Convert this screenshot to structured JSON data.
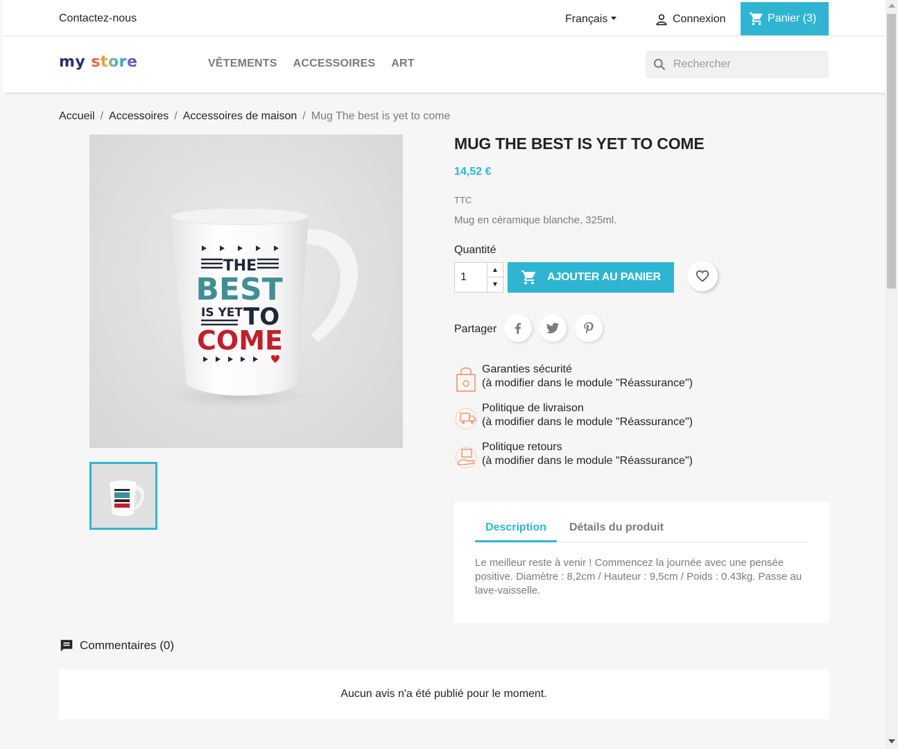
{
  "topbar": {
    "contact": "Contactez-nous",
    "language": "Français",
    "login": "Connexion",
    "cart": "Panier (3)"
  },
  "header": {
    "logo_my": "my",
    "logo_store": "store",
    "nav": [
      "VÊTEMENTS",
      "ACCESSOIRES",
      "ART"
    ],
    "search_placeholder": "Rechercher"
  },
  "breadcrumb": [
    "Accueil",
    "Accessoires",
    "Accessoires de maison",
    "Mug The best is yet to come"
  ],
  "product": {
    "title": "MUG THE BEST IS YET TO COME",
    "price": "14,52 €",
    "tax_label": "TTC",
    "short_description": "Mug en céramique blanche, 325ml.",
    "quantity_label": "Quantité",
    "quantity_value": "1",
    "add_to_cart": "AJOUTER AU PANIER",
    "share_label": "Partager",
    "mug_text": {
      "the": "THE",
      "best": "BEST",
      "is_yet": "IS YET",
      "to": "TO",
      "come": "COME"
    }
  },
  "reassurance": [
    {
      "title": "Garanties sécurité",
      "subtitle": "(à modifier dans le module \"Réassurance\")",
      "icon": "secure-bag-icon"
    },
    {
      "title": "Politique de livraison",
      "subtitle": "(à modifier dans le module \"Réassurance\")",
      "icon": "delivery-truck-icon"
    },
    {
      "title": "Politique retours",
      "subtitle": "(à modifier dans le module \"Réassurance\")",
      "icon": "return-package-icon"
    }
  ],
  "tabs": {
    "description": "Description",
    "details": "Détails du produit",
    "content": "Le meilleur reste à venir ! Commencez la journée avec une pensée positive. Diamètre : 8,2cm / Hauteur : 9,5cm / Poids : 0.43kg. Passe au lave-vaisselle."
  },
  "comments": {
    "heading": "Commentaires (0)",
    "empty": "Aucun avis n'a été publié pour le moment."
  },
  "colors": {
    "accent": "#2fb5d2",
    "mug_teal": "#3f8f93",
    "mug_red": "#c0202a",
    "mug_navy": "#22263a",
    "reassurance_orange": "#f19d76"
  }
}
